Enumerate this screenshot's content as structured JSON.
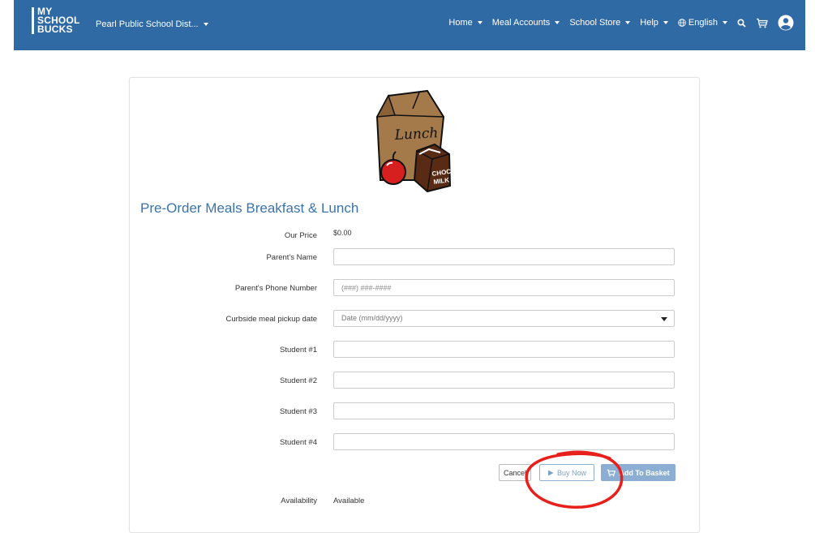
{
  "header": {
    "logo_lines": [
      "MY",
      "SCHOOL",
      "BUCKS"
    ],
    "district": "Pearl Public School Dist...",
    "nav": [
      {
        "label": "Home"
      },
      {
        "label": "Meal Accounts"
      },
      {
        "label": "School Store"
      },
      {
        "label": "Help"
      },
      {
        "label": "English"
      }
    ],
    "icons": [
      "globe-icon",
      "search-icon",
      "cart-icon",
      "user-account-icon"
    ]
  },
  "product": {
    "image_text": "Lunch",
    "milk_text_1": "CHOCO",
    "milk_text_2": "MILK",
    "title": "Pre-Order Meals Breakfast & Lunch",
    "price_label": "Our Price",
    "price_value": "$0.00",
    "fields": {
      "parent_name_label": "Parent's Name",
      "parent_name_value": "",
      "phone_label": "Parent's Phone Number",
      "phone_placeholder": "(###) ###-####",
      "pickup_label": "Curbside meal pickup date",
      "pickup_placeholder": "Date (mm/dd/yyyy)",
      "student1_label": "Student #1",
      "student2_label": "Student #2",
      "student3_label": "Student #3",
      "student4_label": "Student #4"
    },
    "buttons": {
      "cancel": "Cancel",
      "buy_now": "Buy Now",
      "add_to_basket": "Add To Basket"
    },
    "availability_label": "Availability",
    "availability_value": "Available"
  },
  "colors": {
    "header_bg": "#2f6aa5",
    "title": "#3b73aa",
    "button_primary": "#8caed3",
    "annotation": "#e8201c"
  }
}
